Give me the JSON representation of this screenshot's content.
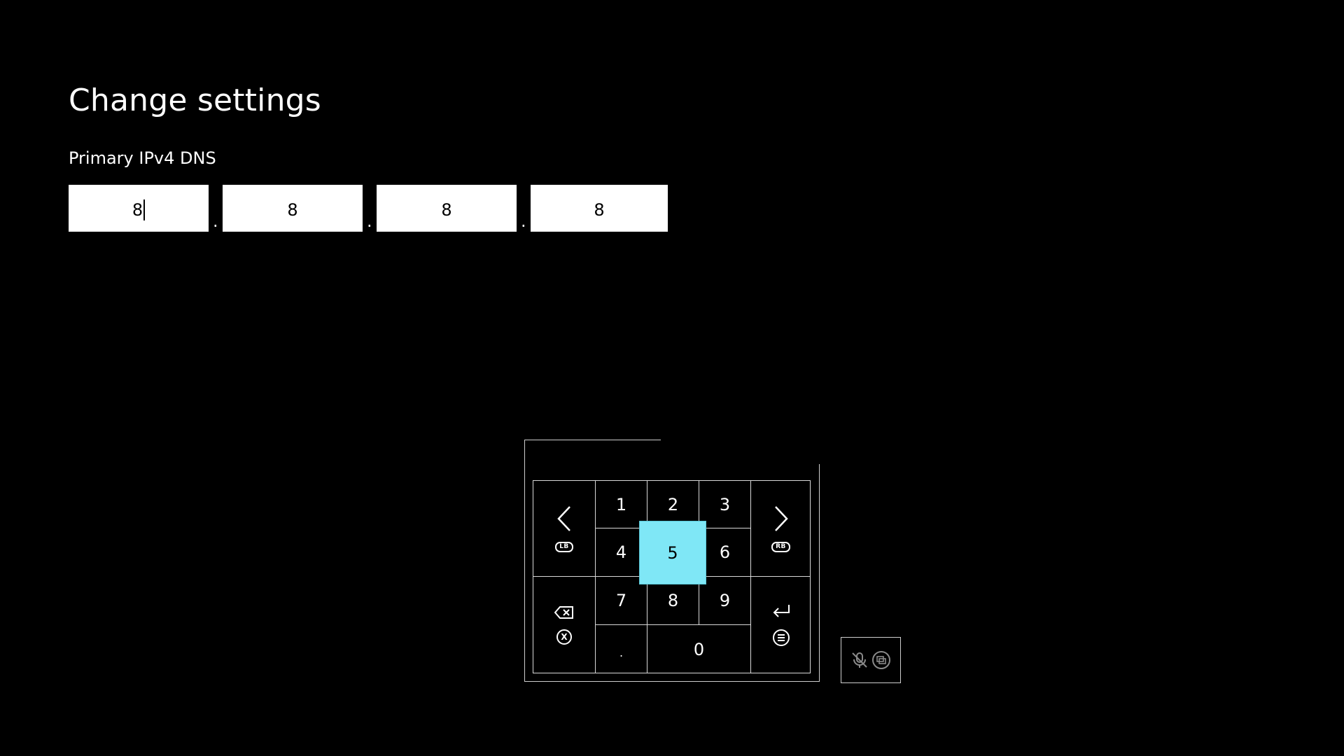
{
  "header": {
    "title": "Change settings"
  },
  "field": {
    "label": "Primary IPv4 DNS"
  },
  "ip_octets": [
    "8",
    "8",
    "8",
    "8"
  ],
  "ip_separator": ".",
  "keypad": {
    "digits": [
      "1",
      "2",
      "3",
      "4",
      "5",
      "6",
      "7",
      "8",
      "9",
      "0"
    ],
    "dot_key": ".",
    "lb_badge": "LB",
    "rb_badge": "RB",
    "x_badge": "X",
    "highlighted_key": "5",
    "highlight_color": "#7fe7f6"
  },
  "icons": {
    "prev": "chevron-left-icon",
    "next": "chevron-right-icon",
    "backspace": "backspace-icon",
    "enter": "enter-icon",
    "menu": "menu-button-icon",
    "mic_muted": "mic-muted-icon",
    "view": "view-button-icon"
  }
}
